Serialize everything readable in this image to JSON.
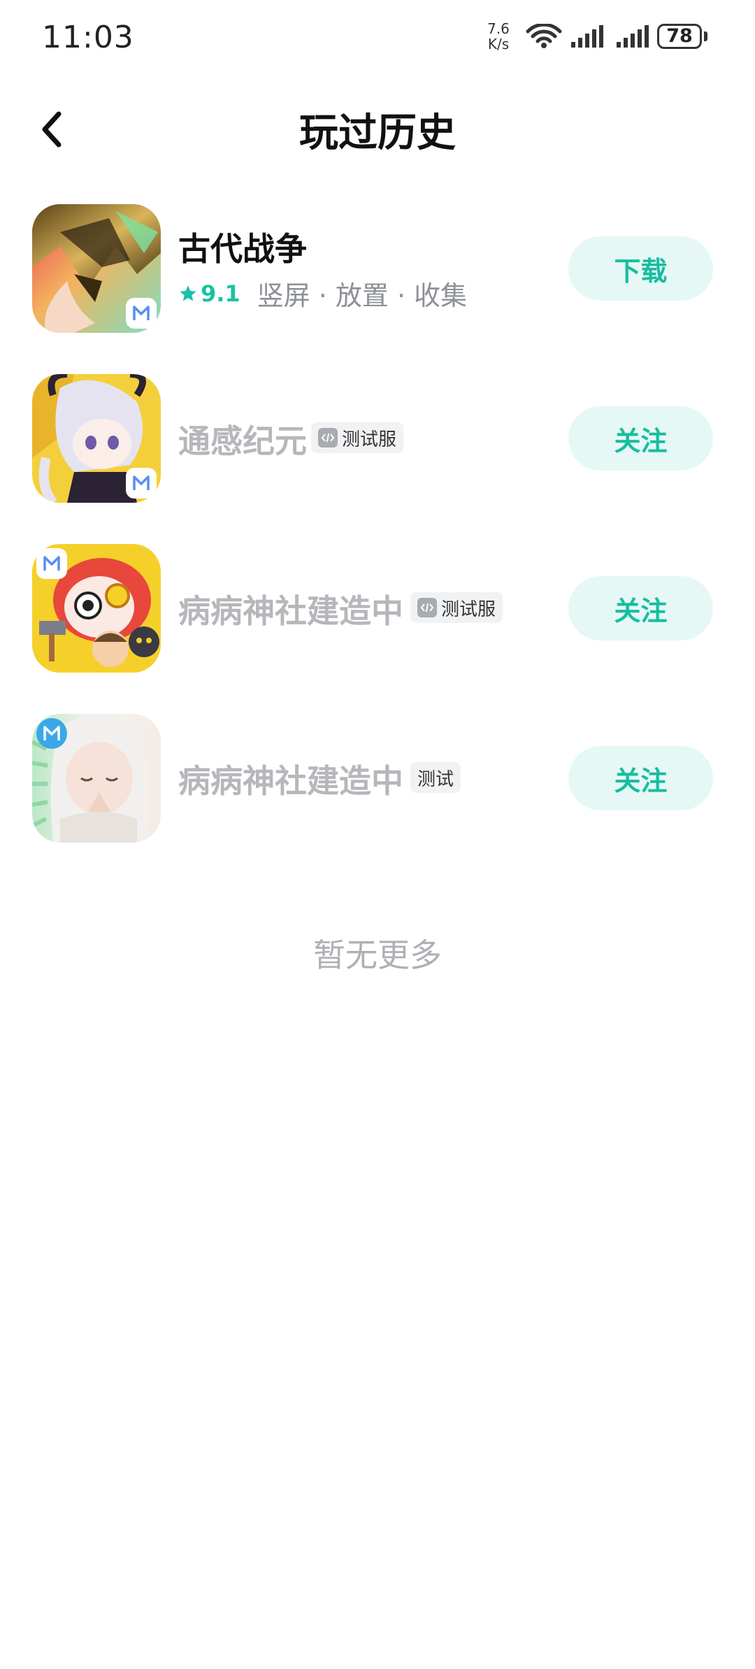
{
  "status_bar": {
    "time": "11:03",
    "net_speed_value": "7.6",
    "net_speed_unit": "K/s",
    "battery": "78"
  },
  "header": {
    "back_icon": "chevron-left-icon",
    "title": "玩过历史"
  },
  "games": [
    {
      "name": "古代战争",
      "rating": "9.1",
      "tags": "竖屏 · 放置 · 收集",
      "action": "下载",
      "active": true
    },
    {
      "name": "通感纪元",
      "badge": "测试服",
      "badge_has_code_icon": true,
      "action": "关注",
      "active": false
    },
    {
      "name": "病病神社建造中",
      "badge": "测试服",
      "badge_has_code_icon": true,
      "action": "关注",
      "active": false
    },
    {
      "name": "病病神社建造中",
      "badge": "测试",
      "badge_has_code_icon": false,
      "action": "关注",
      "active": false
    }
  ],
  "footer": {
    "no_more": "暂无更多"
  },
  "colors": {
    "accent": "#19c2a5",
    "button_bg": "#e6f8f5",
    "dim_text": "#b5b7bb"
  }
}
